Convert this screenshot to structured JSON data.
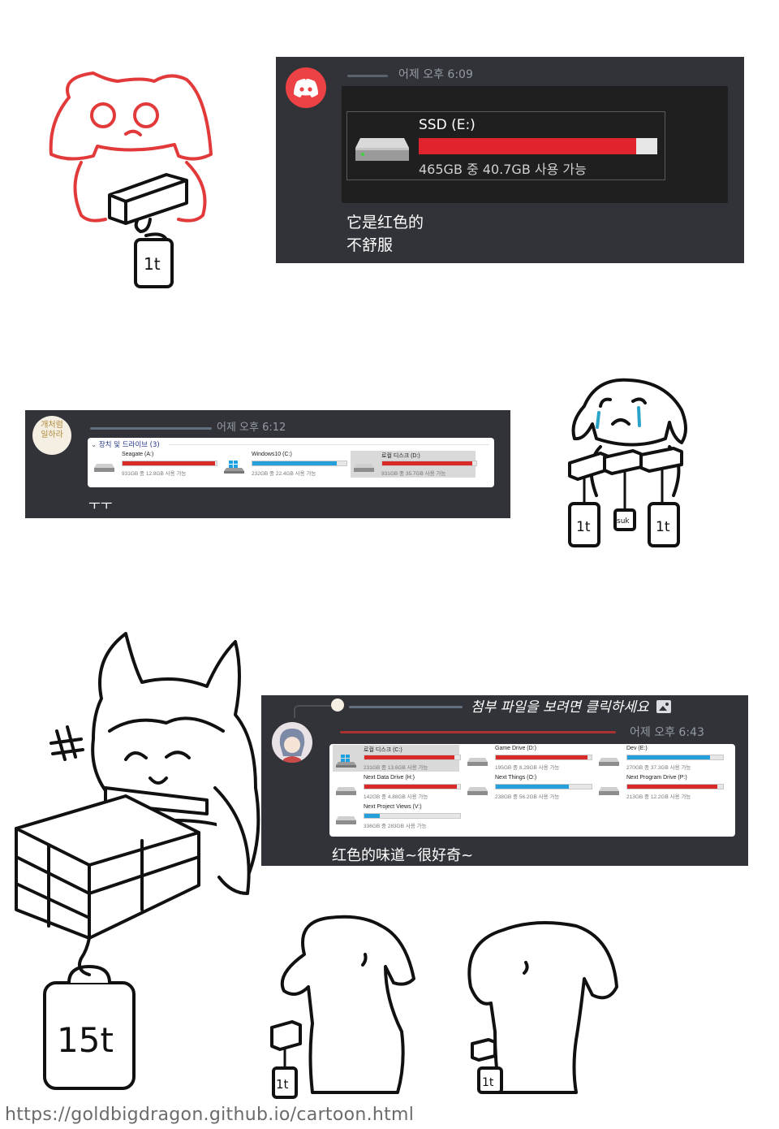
{
  "panel1": {
    "timestamp": "어제 오후 6:09",
    "drive": {
      "name": "SSD (E:)",
      "capacity": "465GB 중 40.7GB 사용 가능",
      "used_fraction": 0.912,
      "fill_color": "#e0242d"
    },
    "message_line1": "它是红色的",
    "message_line2": "不舒服",
    "discord_color": "#ed4245"
  },
  "panel2": {
    "timestamp": "어제 오후 6:12",
    "avatar_text": "개처럼\n일하라",
    "section_header": "장치 및 드라이브 (3)",
    "drives": [
      {
        "name": "Seagate (A:)",
        "capacity": "931GB 중 12.8GB 사용 가능",
        "used_fraction": 0.986,
        "color": "#d92a2a",
        "icon": "hdd-icon"
      },
      {
        "name": "Windows10 (C:)",
        "capacity": "232GB 중 22.4GB 사용 가능",
        "used_fraction": 0.9,
        "color": "#26a0da",
        "icon": "windows-drive-icon"
      },
      {
        "name": "로컬 디스크 (D:)",
        "capacity": "931GB 중 35.7GB 사용 가능",
        "used_fraction": 0.96,
        "color": "#d92a2a",
        "icon": "hdd-icon",
        "selected": true
      }
    ],
    "message": "ㅜㅜ"
  },
  "panel3": {
    "reply_hint": "첨부 파일을 보려면 클릭하세요",
    "timestamp": "어제 오후 6:43",
    "drives": [
      {
        "name": "로컬 디스크 (C:)",
        "capacity": "231GB 중 13.6GB 사용 가능",
        "used_fraction": 0.94,
        "color": "#d92a2a",
        "icon": "windows-drive-icon",
        "selected": true
      },
      {
        "name": "Game Drive (D:)",
        "capacity": "195GB 중 8.29GB 사용 가능",
        "used_fraction": 0.958,
        "color": "#d92a2a",
        "icon": "hdd-icon"
      },
      {
        "name": "Dev (E:)",
        "capacity": "270GB 중 37.3GB 사용 가능",
        "used_fraction": 0.862,
        "color": "#26a0da",
        "icon": "hdd-icon"
      },
      {
        "name": "Next Data Drive (H:)",
        "capacity": "142GB 중 4.88GB 사용 가능",
        "used_fraction": 0.966,
        "color": "#d92a2a",
        "icon": "hdd-icon"
      },
      {
        "name": "Next Things (O:)",
        "capacity": "238GB 중 56.2GB 사용 가능",
        "used_fraction": 0.764,
        "color": "#26a0da",
        "icon": "hdd-icon"
      },
      {
        "name": "Next Program Drive (P:)",
        "capacity": "213GB 중 12.2GB 사용 가능",
        "used_fraction": 0.943,
        "color": "#d92a2a",
        "icon": "hdd-icon"
      },
      {
        "name": "Next Project Views (V:)",
        "capacity": "336GB 중 283GB 사용 가능",
        "used_fraction": 0.158,
        "color": "#26a0da",
        "icon": "hdd-icon"
      }
    ],
    "message": "红色的味道~很好奇~"
  },
  "sketch_labels": {
    "weight_1t": "1t",
    "weight_suk": "suk",
    "weight_15t": "15t",
    "hash_mark": "#"
  },
  "footer": "https://goldbigdragon.github.io/cartoon.html"
}
